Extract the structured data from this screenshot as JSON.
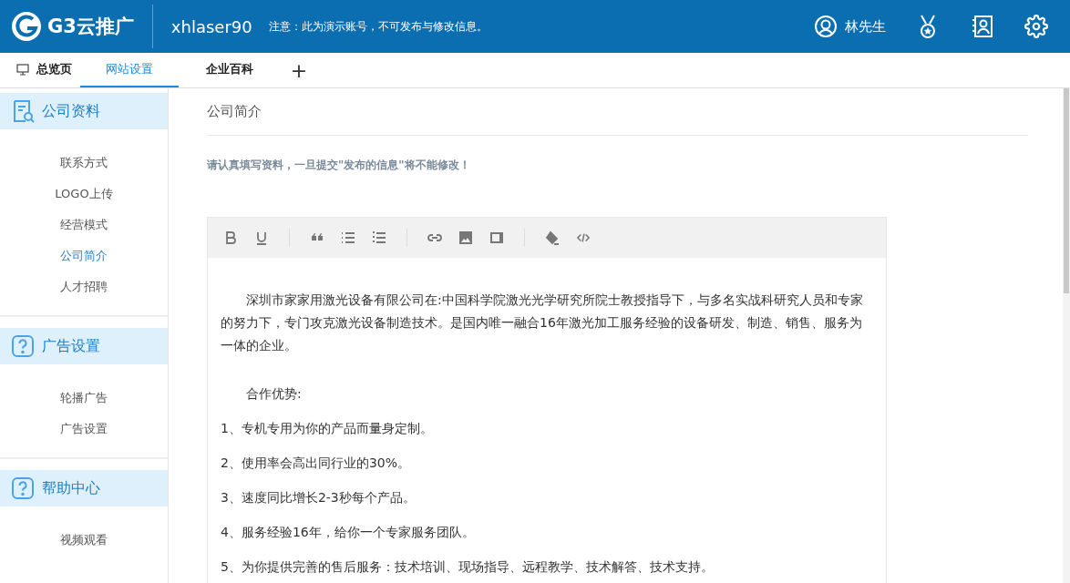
{
  "header": {
    "logo_text": "G3云推广",
    "account": "xhlaser90",
    "notice": "注意：此为演示账号，不可发布与修改信息。",
    "user": "林先生"
  },
  "tabs": [
    {
      "label": "总览页",
      "kind": "overview",
      "selected": false
    },
    {
      "label": "网站设置",
      "kind": "plain",
      "selected": true
    },
    {
      "label": "企业百科",
      "kind": "plain",
      "selected": false
    },
    {
      "label": "+",
      "kind": "add",
      "selected": false
    }
  ],
  "sidebar": [
    {
      "title": "公司资料",
      "kind": "profile",
      "items": [
        {
          "label": "联系方式",
          "selected": false
        },
        {
          "label": "LOGO上传",
          "selected": false
        },
        {
          "label": "经营模式",
          "selected": false
        },
        {
          "label": "公司简介",
          "selected": true
        },
        {
          "label": "人才招聘",
          "selected": false
        }
      ]
    },
    {
      "title": "广告设置",
      "kind": "help",
      "items": [
        {
          "label": "轮播广告",
          "selected": false
        },
        {
          "label": "广告设置",
          "selected": false
        }
      ]
    },
    {
      "title": "帮助中心",
      "kind": "help",
      "items": [
        {
          "label": "视频观看",
          "selected": false
        }
      ]
    }
  ],
  "content": {
    "title": "公司简介",
    "warning": "请认真填写资料，一旦提交\"发布的信息\"将不能修改！",
    "paragraphs": [
      {
        "text": "深圳市家家用激光设备有限公司在:中国科学院激光光学研究所院士教授指导下，与多名实战科研究人员和专家的努力下，专门攻克激光设备制造技术。是国内唯一融合16年激光加工服务经验的设备研发、制造、销售、服务为一体的企业。",
        "kind": "lead"
      },
      {
        "text": "合作优势:",
        "kind": "indent"
      },
      {
        "text": "1、专机专用为你的产品而量身定制。",
        "kind": "plain"
      },
      {
        "text": "2、使用率会高出同行业的30%。",
        "kind": "plain"
      },
      {
        "text": "3、速度同比增长2-3秒每个产品。",
        "kind": "plain"
      },
      {
        "text": "4、服务经验16年，给你一个专家服务团队。",
        "kind": "plain"
      },
      {
        "text": "5、为你提供完善的售后服务：技术培训、现场指导、远程教学、技术解答、技术支持。",
        "kind": "plain"
      }
    ]
  }
}
